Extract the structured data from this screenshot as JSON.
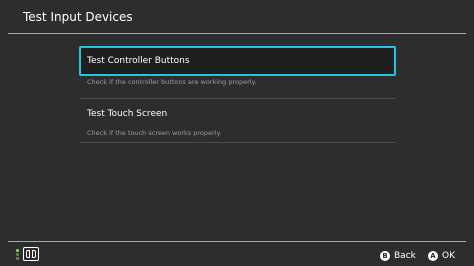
{
  "header": {
    "title": "Test Input Devices"
  },
  "menu": {
    "items": [
      {
        "label": "Test Controller Buttons",
        "description": "Check if the controller buttons are working properly.",
        "selected": true
      },
      {
        "label": "Test Touch Screen",
        "description": "Check if the touch screen works properly.",
        "selected": false
      }
    ]
  },
  "footer": {
    "controller_icon": "joycon-icon",
    "back": {
      "glyph": "B",
      "label": "Back"
    },
    "ok": {
      "glyph": "A",
      "label": "OK"
    }
  },
  "colors": {
    "background": "#2d2d2d",
    "selection_border": "#23c4e8",
    "selected_bg": "#1f1f1f",
    "description_text": "#9c9c9c",
    "player_led": "#7fd34a"
  }
}
